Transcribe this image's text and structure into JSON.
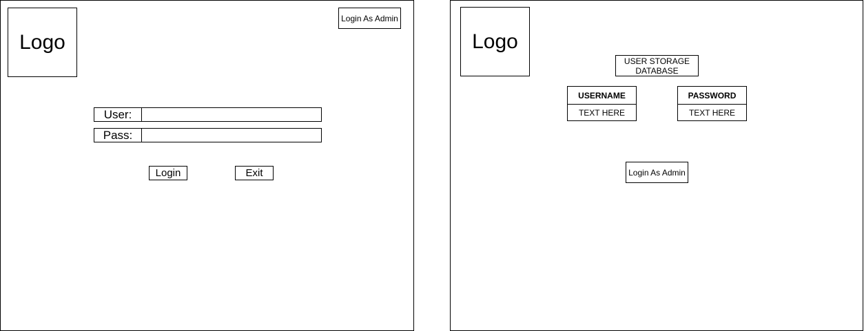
{
  "left_screen": {
    "logo_text": "Logo",
    "login_as_admin_label": "Login As Admin",
    "user_label": "User:",
    "user_value": "",
    "pass_label": "Pass:",
    "pass_value": "",
    "login_label": "Login",
    "exit_label": "Exit"
  },
  "right_screen": {
    "logo_text": "Logo",
    "storage_title": "USER STORAGE DATABASE",
    "table": {
      "columns": [
        {
          "header": "USERNAME",
          "value": "TEXT HERE"
        },
        {
          "header": "PASSWORD",
          "value": "TEXT HERE"
        }
      ]
    },
    "login_as_admin_label": "Login As Admin"
  }
}
